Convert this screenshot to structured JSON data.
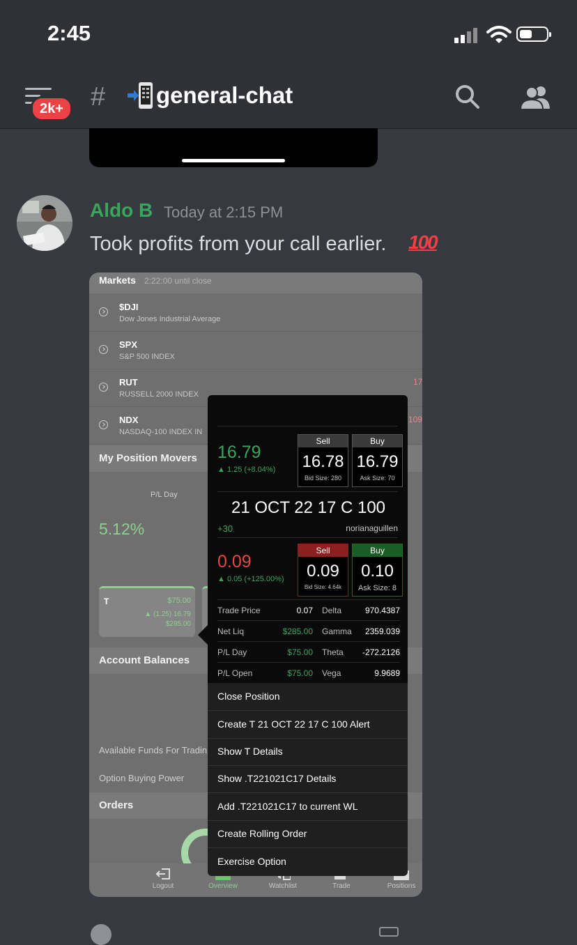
{
  "status_bar": {
    "time": "2:45"
  },
  "header": {
    "unread_badge": "2k+",
    "channel_prefix": "#",
    "channel_name": "general-chat"
  },
  "message": {
    "author": "Aldo B",
    "timestamp": "Today at 2:15 PM",
    "text": "Took profits from your call earlier.",
    "emoji": "100",
    "author_color": "#3ba55d"
  },
  "screenshot": {
    "markets_title": "Markets",
    "markets_subtitle": "2:22:00 until close",
    "markets": [
      {
        "symbol": "$DJI",
        "name": "Dow Jones Industrial Average",
        "value": ""
      },
      {
        "symbol": "SPX",
        "name": "S&P 500 INDEX",
        "value": ""
      },
      {
        "symbol": "RUT",
        "name": "RUSSELL 2000 INDEX",
        "value": "17"
      },
      {
        "symbol": "NDX",
        "name": "NASDAQ-100 INDEX IN",
        "value": "109"
      }
    ],
    "position_movers_title": "My Position Movers",
    "pl_day_label": "P/L Day",
    "pl_day_value": "5.12%",
    "card": {
      "symbol": "T",
      "value1": "$75.00",
      "value2": "▲ (1.25) 16.79",
      "value3": "$285.00"
    },
    "account_balances_title": "Account Balances",
    "available_funds_label": "Available Funds For Tradin",
    "option_buying_power_label": "Option Buying Power",
    "orders_title": "Orders",
    "tabs": [
      {
        "label": "Logout",
        "icon": "logout-icon"
      },
      {
        "label": "Overview",
        "icon": "overview-icon"
      },
      {
        "label": "Watchlist",
        "icon": "watchlist-icon"
      },
      {
        "label": "Trade",
        "icon": "trade-icon"
      },
      {
        "label": "Positions",
        "icon": "positions-icon"
      }
    ],
    "popup": {
      "stock": {
        "last": "16.79",
        "change": "▲ 1.25 (+8.04%)",
        "sell_label": "Sell",
        "sell_price": "16.78",
        "sell_size": "Bid Size: 280",
        "buy_label": "Buy",
        "buy_price": "16.79",
        "buy_size": "Ask Size: 70"
      },
      "option_name": "21 OCT 22 17 C 100",
      "option_change": "+30",
      "option_user": "norianaguillen",
      "option": {
        "last": "0.09",
        "change": "▲ 0.05 (+125.00%)",
        "sell_label": "Sell",
        "sell_price": "0.09",
        "sell_size": "Bid Size: 4.64k",
        "buy_label": "Buy",
        "buy_price": "0.10",
        "buy_size": "Ask Size: 8"
      },
      "greeks": [
        {
          "k1": "Trade Price",
          "v1": "0.07",
          "k2": "Delta",
          "v2": "970.4387"
        },
        {
          "k1": "Net Liq",
          "v1": "$285.00",
          "k2": "Gamma",
          "v2": "2359.039"
        },
        {
          "k1": "P/L Day",
          "v1": "$75.00",
          "k2": "Theta",
          "v2": "-272.2126"
        },
        {
          "k1": "P/L Open",
          "v1": "$75.00",
          "k2": "Vega",
          "v2": "9.9689"
        }
      ],
      "menu": [
        "Close Position",
        "Create T 21 OCT 22 17 C 100 Alert",
        "Show T Details",
        "Show .T221021C17 Details",
        "Add .T221021C17 to current WL",
        "Create Rolling Order",
        "Exercise Option"
      ]
    }
  }
}
